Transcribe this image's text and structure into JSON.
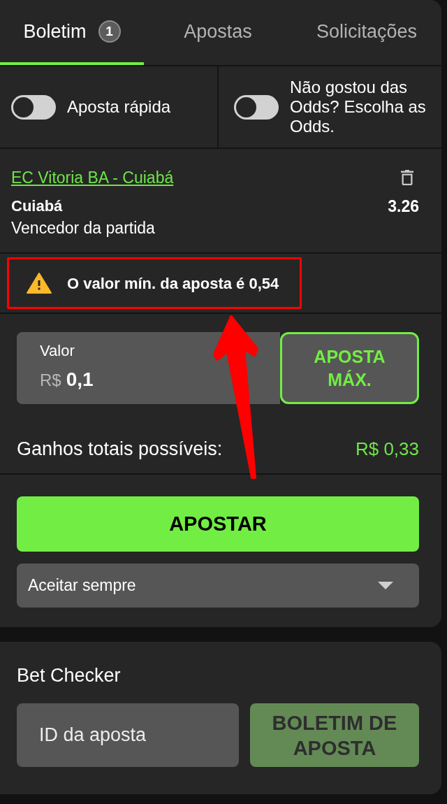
{
  "tabs": [
    {
      "label": "Boletim",
      "badge": "1",
      "selected": true
    },
    {
      "label": "Apostas",
      "selected": false
    },
    {
      "label": "Solicitações",
      "selected": false
    }
  ],
  "toggles": [
    {
      "label": "Aposta rápida",
      "on": false
    },
    {
      "label": "Não gostou das Odds? Escolha as Odds.",
      "on": false
    }
  ],
  "selection": {
    "event": "EC Vitoria BA - Cuiabá",
    "pick": "Cuiabá",
    "odds": "3.26",
    "market": "Vencedor da partida"
  },
  "warning": {
    "text": "O valor mín. da aposta é 0,54"
  },
  "stake": {
    "label": "Valor",
    "currency": "R$",
    "value": "0,1",
    "max_button": "APOSTA MÁX."
  },
  "potential_winnings": {
    "label": "Ganhos totais possíveis:",
    "value": "R$ 0,33"
  },
  "place_bet_button": "APOSTAR",
  "odds_acceptance": {
    "value": "Aceitar sempre"
  },
  "bet_checker": {
    "title": "Bet Checker",
    "placeholder": "ID da aposta",
    "button": "BOLETIM DE APOSTA"
  },
  "annotations": {
    "highlight_frame": true,
    "arrow": true
  }
}
